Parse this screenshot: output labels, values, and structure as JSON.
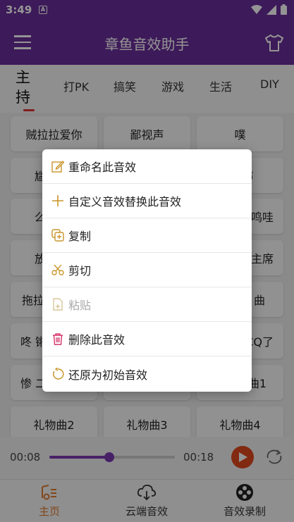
{
  "status": {
    "time": "3:49",
    "notif": "A"
  },
  "app": {
    "title": "章鱼音效助手"
  },
  "tabs": [
    {
      "label": "主持"
    },
    {
      "label": "打PK"
    },
    {
      "label": "搞笑"
    },
    {
      "label": "游戏"
    },
    {
      "label": "生活"
    },
    {
      "label": "DIY"
    }
  ],
  "grid": [
    [
      "贼拉拉爱你",
      "鄙视声",
      "噗"
    ],
    [
      "尴",
      "",
      "声"
    ],
    [
      "么",
      "",
      "鸣哇"
    ],
    [
      "放",
      "",
      "主席"
    ],
    [
      "拖拉",
      "",
      "曲"
    ],
    [
      "咚 锵",
      "",
      "CQ了"
    ],
    [
      "惨 二",
      "",
      "曲1"
    ],
    [
      "礼物曲2",
      "礼物曲3",
      "礼物曲4"
    ]
  ],
  "popup": {
    "items": [
      {
        "label": "重命名此音效",
        "icon": "edit-icon",
        "enabled": true
      },
      {
        "label": "自定义音效替换此音效",
        "icon": "plus-icon",
        "enabled": true
      },
      {
        "label": "复制",
        "icon": "copy-icon",
        "enabled": true
      },
      {
        "label": "剪切",
        "icon": "scissors-icon",
        "enabled": true
      },
      {
        "label": "粘贴",
        "icon": "paste-icon",
        "enabled": false
      },
      {
        "label": "删除此音效",
        "icon": "trash-icon",
        "enabled": true
      },
      {
        "label": "还原为初始音效",
        "icon": "restore-icon",
        "enabled": true
      }
    ]
  },
  "player": {
    "current": "00:08",
    "total": "00:18",
    "progress": 0.48
  },
  "nav": [
    {
      "label": "主页",
      "icon": "home-music-icon",
      "active": true
    },
    {
      "label": "云端音效",
      "icon": "cloud-download-icon",
      "active": false
    },
    {
      "label": "音效录制",
      "icon": "film-reel-icon",
      "active": false
    }
  ],
  "colors": {
    "primary": "#6a2d9a",
    "accent": "#e07b2e",
    "play": "#e0471e",
    "icon_gold": "#c9952b"
  }
}
